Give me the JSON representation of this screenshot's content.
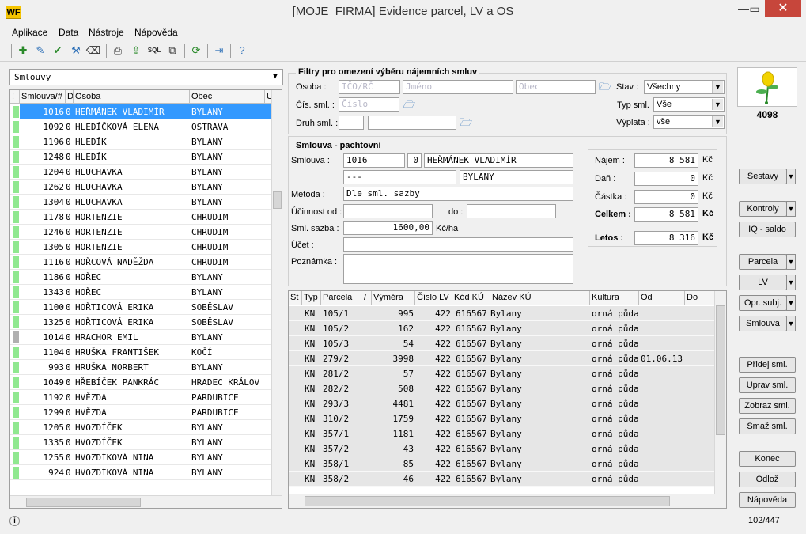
{
  "window": {
    "title": "[MOJE_FIRMA] Evidence parcel, LV a OS",
    "logo": "WF"
  },
  "menu": [
    "Aplikace",
    "Data",
    "Nástroje",
    "Nápověda"
  ],
  "toolbar_icons": [
    "new-doc-icon",
    "edit-icon",
    "approve-icon",
    "tools-icon",
    "eraser-icon",
    "print-icon",
    "export-icon",
    "sql-icon",
    "copy-icon",
    "refresh-icon",
    "exit-icon",
    "help-icon"
  ],
  "toolbar_sql": "SQL",
  "left": {
    "combo_value": "Smlouvy",
    "columns": [
      "!",
      "Smlouva/#",
      "D",
      "Osoba",
      "Obec",
      "U"
    ],
    "rows": [
      {
        "id": "1016",
        "d": "0",
        "osoba": "HEŘMÁNEK VLADIMÍR",
        "obec": "BYLANY",
        "mark": "green",
        "selected": true
      },
      {
        "id": "1092",
        "d": "0",
        "osoba": "HLEDÍČKOVÁ ELENA",
        "obec": "OSTRAVA",
        "mark": "green"
      },
      {
        "id": "1196",
        "d": "0",
        "osoba": "HLEDÍK",
        "obec": "BYLANY",
        "mark": "green"
      },
      {
        "id": "1248",
        "d": "0",
        "osoba": "HLEDÍK",
        "obec": "BYLANY",
        "mark": "green"
      },
      {
        "id": "1204",
        "d": "0",
        "osoba": "HLUCHAVKA",
        "obec": "BYLANY",
        "mark": "green"
      },
      {
        "id": "1262",
        "d": "0",
        "osoba": "HLUCHAVKA",
        "obec": "BYLANY",
        "mark": "green"
      },
      {
        "id": "1304",
        "d": "0",
        "osoba": "HLUCHAVKA",
        "obec": "BYLANY",
        "mark": "green"
      },
      {
        "id": "1178",
        "d": "0",
        "osoba": "HORTENZIE",
        "obec": "CHRUDIM",
        "mark": "green"
      },
      {
        "id": "1246",
        "d": "0",
        "osoba": "HORTENZIE",
        "obec": "CHRUDIM",
        "mark": "green"
      },
      {
        "id": "1305",
        "d": "0",
        "osoba": "HORTENZIE",
        "obec": "CHRUDIM",
        "mark": "green"
      },
      {
        "id": "1116",
        "d": "0",
        "osoba": "HOŘCOVÁ NADĚŽDA",
        "obec": "CHRUDIM",
        "mark": "green"
      },
      {
        "id": "1186",
        "d": "0",
        "osoba": "HOŘEC",
        "obec": "BYLANY",
        "mark": "green"
      },
      {
        "id": "1343",
        "d": "0",
        "osoba": "HOŘEC",
        "obec": "BYLANY",
        "mark": "green"
      },
      {
        "id": "1100",
        "d": "0",
        "osoba": "HOŘTICOVÁ ERIKA",
        "obec": "SOBĚSLAV",
        "mark": "green"
      },
      {
        "id": "1325",
        "d": "0",
        "osoba": "HOŘTICOVÁ ERIKA",
        "obec": "SOBĚSLAV",
        "mark": "green"
      },
      {
        "id": "1014",
        "d": "0",
        "osoba": "HRACHOR EMIL",
        "obec": "BYLANY",
        "mark": "gray"
      },
      {
        "id": "1104",
        "d": "0",
        "osoba": "HRUŠKA FRANTIŠEK",
        "obec": "KOČÍ",
        "mark": "green"
      },
      {
        "id": "993",
        "d": "0",
        "osoba": "HRUŠKA NORBERT",
        "obec": "BYLANY",
        "mark": "green"
      },
      {
        "id": "1049",
        "d": "0",
        "osoba": "HŘEBÍČEK PANKRÁC",
        "obec": "HRADEC KRÁLOV",
        "mark": "green"
      },
      {
        "id": "1192",
        "d": "0",
        "osoba": "HVĚZDA",
        "obec": "PARDUBICE",
        "mark": "green"
      },
      {
        "id": "1299",
        "d": "0",
        "osoba": "HVĚZDA",
        "obec": "PARDUBICE",
        "mark": "green"
      },
      {
        "id": "1205",
        "d": "0",
        "osoba": "HVOZDÍČEK",
        "obec": "BYLANY",
        "mark": "green"
      },
      {
        "id": "1335",
        "d": "0",
        "osoba": "HVOZDÍČEK",
        "obec": "BYLANY",
        "mark": "green"
      },
      {
        "id": "1255",
        "d": "0",
        "osoba": "HVOZDÍKOVÁ NINA",
        "obec": "BYLANY",
        "mark": "green"
      },
      {
        "id": "924",
        "d": "0",
        "osoba": "HVOZDÍKOVÁ NINA",
        "obec": "BYLANY",
        "mark": "green"
      }
    ]
  },
  "filters": {
    "title": "Filtry pro omezení výběru nájemních smluv",
    "osoba_label": "Osoba :",
    "ico_ph": "IČO/RČ",
    "jmeno_ph": "Jméno",
    "obec_ph": "Obec",
    "cis_label": "Čís. sml. :",
    "cislo_ph": "Číslo",
    "druh_label": "Druh sml. :",
    "stav_label": "Stav :",
    "stav_value": "Všechny",
    "typ_label": "Typ sml. :",
    "typ_value": "Vše",
    "vyplata_label": "Výplata :",
    "vyplata_value": "vše"
  },
  "contract": {
    "title": "Smlouva - pachtovní",
    "smlouva_label": "Smlouva :",
    "smlouva_no": "1016",
    "smlouva_d": "0",
    "osoba": "HEŘMÁNEK VLADIMÍR",
    "addr1": "---",
    "addr2": "BYLANY",
    "metoda_label": "Metoda :",
    "metoda": "Dle sml. sazby",
    "ucinnost_label": "Účinnost od :",
    "do_label": "do :",
    "sazba_label": "Sml. sazba :",
    "sazba": "1600,00",
    "sazba_unit": "Kč/ha",
    "ucet_label": "Účet :",
    "poznamka_label": "Poznámka :"
  },
  "summary": {
    "najem_label": "Nájem :",
    "najem": "8 581",
    "dan_label": "Daň :",
    "dan": "0",
    "castka_label": "Částka :",
    "castka": "0",
    "celkem_label": "Celkem :",
    "celkem": "8 581",
    "letos_label": "Letos :",
    "letos": "8 316",
    "currency": "Kč"
  },
  "parcels": {
    "columns": [
      "St",
      "Typ",
      "Parcela",
      "/",
      "Výměra",
      "Číslo LV",
      "Kód KÚ",
      "Název KÚ",
      "Kultura",
      "Od",
      "Do"
    ],
    "rows": [
      {
        "typ": "KN",
        "parcela": "105/1",
        "vymera": "995",
        "lv": "422",
        "ku": "616567",
        "nazev": "Bylany",
        "kultura": "orná půda",
        "od": ""
      },
      {
        "typ": "KN",
        "parcela": "105/2",
        "vymera": "162",
        "lv": "422",
        "ku": "616567",
        "nazev": "Bylany",
        "kultura": "orná půda",
        "od": ""
      },
      {
        "typ": "KN",
        "parcela": "105/3",
        "vymera": "54",
        "lv": "422",
        "ku": "616567",
        "nazev": "Bylany",
        "kultura": "orná půda",
        "od": ""
      },
      {
        "typ": "KN",
        "parcela": "279/2",
        "vymera": "3998",
        "lv": "422",
        "ku": "616567",
        "nazev": "Bylany",
        "kultura": "orná půda",
        "od": "01.06.13"
      },
      {
        "typ": "KN",
        "parcela": "281/2",
        "vymera": "57",
        "lv": "422",
        "ku": "616567",
        "nazev": "Bylany",
        "kultura": "orná půda",
        "od": ""
      },
      {
        "typ": "KN",
        "parcela": "282/2",
        "vymera": "508",
        "lv": "422",
        "ku": "616567",
        "nazev": "Bylany",
        "kultura": "orná půda",
        "od": ""
      },
      {
        "typ": "KN",
        "parcela": "293/3",
        "vymera": "4481",
        "lv": "422",
        "ku": "616567",
        "nazev": "Bylany",
        "kultura": "orná půda",
        "od": ""
      },
      {
        "typ": "KN",
        "parcela": "310/2",
        "vymera": "1759",
        "lv": "422",
        "ku": "616567",
        "nazev": "Bylany",
        "kultura": "orná půda",
        "od": ""
      },
      {
        "typ": "KN",
        "parcela": "357/1",
        "vymera": "1181",
        "lv": "422",
        "ku": "616567",
        "nazev": "Bylany",
        "kultura": "orná půda",
        "od": ""
      },
      {
        "typ": "KN",
        "parcela": "357/2",
        "vymera": "43",
        "lv": "422",
        "ku": "616567",
        "nazev": "Bylany",
        "kultura": "orná půda",
        "od": ""
      },
      {
        "typ": "KN",
        "parcela": "358/1",
        "vymera": "85",
        "lv": "422",
        "ku": "616567",
        "nazev": "Bylany",
        "kultura": "orná půda",
        "od": ""
      },
      {
        "typ": "KN",
        "parcela": "358/2",
        "vymera": "46",
        "lv": "422",
        "ku": "616567",
        "nazev": "Bylany",
        "kultura": "orná půda",
        "od": ""
      }
    ]
  },
  "side": {
    "count": "4098",
    "buttons": {
      "sestavy": "Sestavy",
      "kontroly": "Kontroly",
      "iq": "IQ - saldo",
      "parcela": "Parcela",
      "lv": "LV",
      "opr": "Opr. subj.",
      "smlouva": "Smlouva",
      "pridej": "Přidej sml.",
      "uprav": "Uprav sml.",
      "zobraz": "Zobraz sml.",
      "smaz": "Smaž sml.",
      "konec": "Konec",
      "odloz": "Odlož",
      "napoveda": "Nápověda"
    }
  },
  "status": {
    "position": "102/447"
  },
  "colors": {
    "selection": "#3399ff",
    "mark_green": "#90e890",
    "close": "#c7463b",
    "logo": "#f5c400"
  }
}
